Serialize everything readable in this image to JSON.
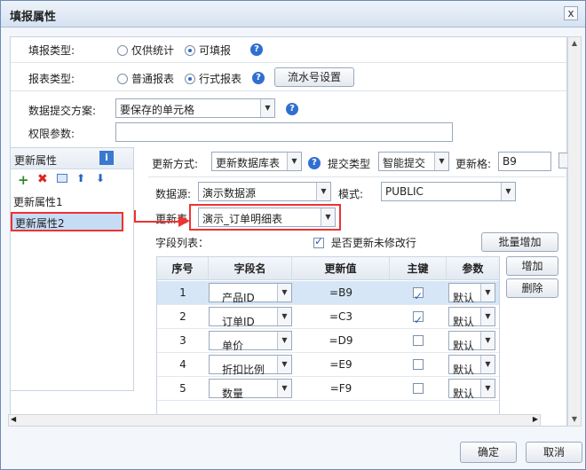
{
  "window": {
    "title": "填报属性",
    "close": "x"
  },
  "fill_type": {
    "label": "填报类型:",
    "options": [
      "仅供统计",
      "可填报"
    ],
    "selected": 1
  },
  "report_type": {
    "label": "报表类型:",
    "options": [
      "普通报表",
      "行式报表"
    ],
    "selected": 1,
    "serial_button": "流水号设置"
  },
  "submit_plan": {
    "label": "数据提交方案:",
    "value": "要保存的单元格"
  },
  "permission": {
    "label": "权限参数:",
    "value": ""
  },
  "update_props": {
    "header": "更新属性",
    "items": [
      "更新属性1",
      "更新属性2"
    ],
    "selected": 1,
    "toolbar_icons": [
      "add-icon",
      "delete-icon",
      "copy-icon",
      "up-icon",
      "down-icon"
    ]
  },
  "right": {
    "update_mode_label": "更新方式:",
    "update_mode_value": "更新数据库表",
    "submit_type_label": "提交类型",
    "submit_type_value": "智能提交",
    "update_cell_label": "更新格:",
    "update_cell_value": "B9",
    "datasource_label": "数据源:",
    "datasource_value": "演示数据源",
    "schema_label": "模式:",
    "schema_value": "PUBLIC",
    "update_table_label": "更新表",
    "update_table_value": "演示_订单明细表",
    "fields_label": "字段列表：",
    "update_unmodified_label": "是否更新未修改行",
    "update_unmodified_checked": true,
    "batch_add": "批量增加",
    "add": "增加",
    "remove": "删除"
  },
  "table": {
    "headers": [
      "序号",
      "字段名",
      "更新值",
      "主键",
      "参数"
    ],
    "rows": [
      {
        "no": "1",
        "field": "产品ID",
        "value": "=B9",
        "key": true,
        "param": "默认"
      },
      {
        "no": "2",
        "field": "订单ID",
        "value": "=C3",
        "key": true,
        "param": "默认"
      },
      {
        "no": "3",
        "field": "单价",
        "value": "=D9",
        "key": false,
        "param": "默认"
      },
      {
        "no": "4",
        "field": "折扣比例",
        "value": "=E9",
        "key": false,
        "param": "默认"
      },
      {
        "no": "5",
        "field": "数量",
        "value": "=F9",
        "key": false,
        "param": "默认"
      }
    ],
    "selected_row": 0
  },
  "footer": {
    "ok": "确定",
    "cancel": "取消"
  },
  "colors": {
    "accent": "#2f6fd0",
    "highlight": "#e33333",
    "selected": "#c6dcf5"
  }
}
